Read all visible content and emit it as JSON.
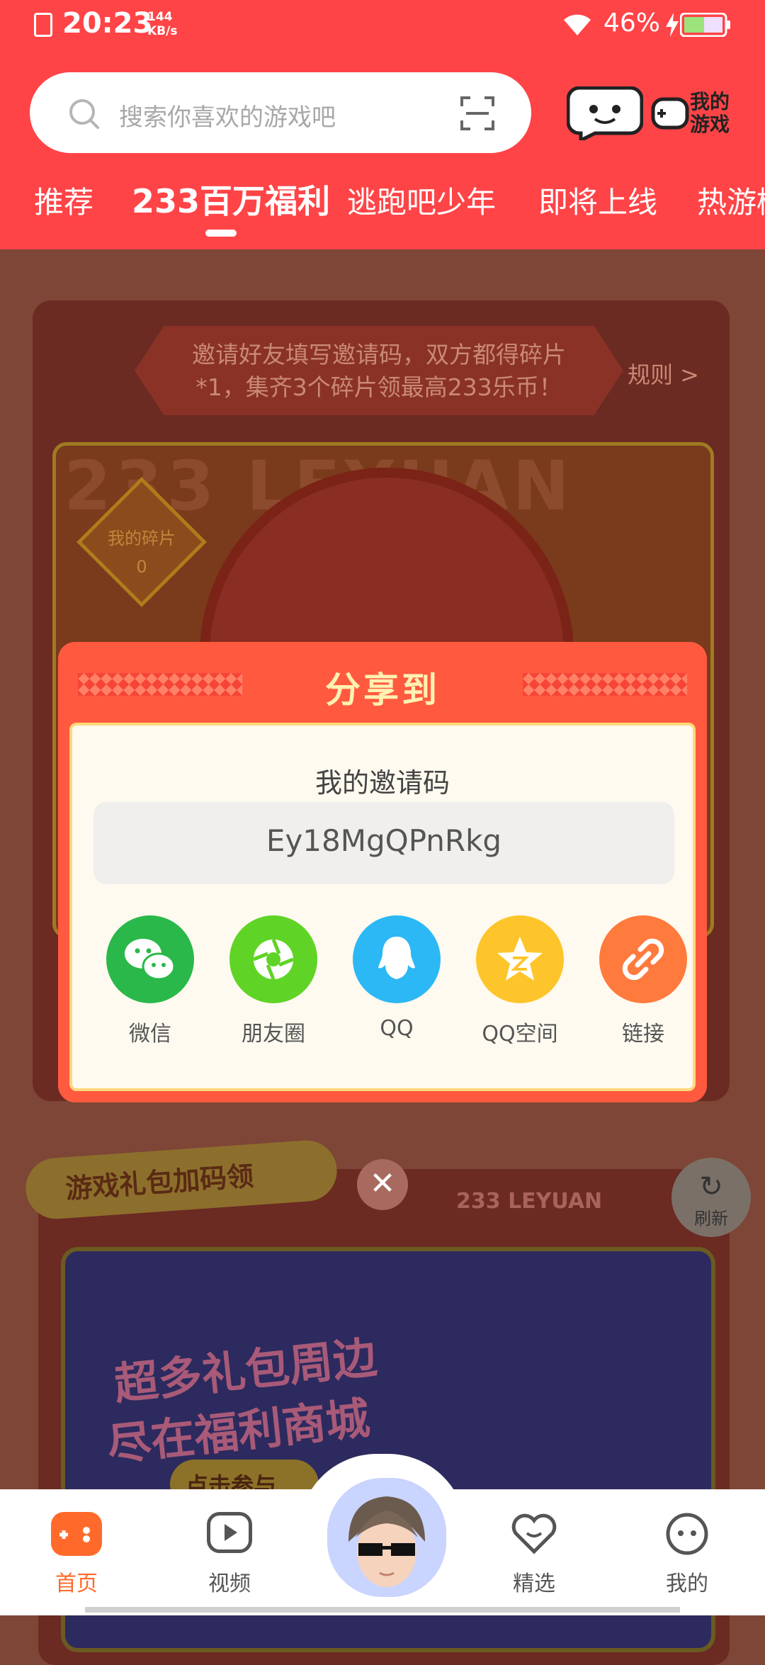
{
  "status": {
    "time": "20:23",
    "speed_value": "144",
    "speed_unit": "KB/s",
    "battery": "46%"
  },
  "header": {
    "search_placeholder": "搜索你喜欢的游戏吧",
    "my_games_label": "我的\n游戏",
    "tabs": [
      "推荐",
      "233百万福利",
      "逃跑吧少年",
      "即将上线",
      "热游榜"
    ],
    "active_tab": 1
  },
  "background": {
    "invite_text": "邀请好友填写邀请码，双方都得碎片*1，集齐3个碎片领最高233乐币！",
    "rules_label": "规则 >",
    "watermark": "233 LEYUAN",
    "fragment_label": "我的碎片",
    "fragment_count": "0",
    "gift_section_title": "游戏礼包加码领",
    "leyuan_brand": "233 LEYUAN",
    "promo_line1": "超多礼包周边",
    "promo_line2": "尽在福利商城",
    "promo_button": "点击参与",
    "refresh_label": "刷新"
  },
  "dialog": {
    "title": "分享到",
    "code_label": "我的邀请码",
    "code_value": "Ey18MgQPnRkg",
    "share_options": [
      {
        "label": "微信",
        "color": "#2bb84a",
        "icon": "wechat-icon"
      },
      {
        "label": "朋友圈",
        "color": "#5fd426",
        "icon": "moments-icon"
      },
      {
        "label": "QQ",
        "color": "#2cb8f5",
        "icon": "qq-icon"
      },
      {
        "label": "QQ空间",
        "color": "#fdc52b",
        "icon": "qzone-icon"
      },
      {
        "label": "链接",
        "color": "#ff7a3d",
        "icon": "link-icon"
      }
    ]
  },
  "nav": {
    "items": [
      {
        "label": "首页",
        "active": true
      },
      {
        "label": "视频"
      },
      {
        "label": "精选"
      },
      {
        "label": "我的"
      }
    ]
  },
  "colors": {
    "brand_red": "#ff4447",
    "accent_orange": "#ff6a2a"
  }
}
